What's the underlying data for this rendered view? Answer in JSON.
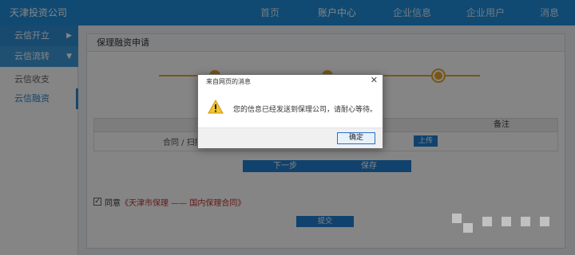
{
  "header": {
    "brand": "天津投资公司",
    "nav": [
      {
        "label": "首页"
      },
      {
        "label": "账户中心"
      },
      {
        "label": "企业信息"
      },
      {
        "label": "企业用户"
      },
      {
        "label": "消息"
      }
    ]
  },
  "sidebar": {
    "group1": "云信开立",
    "group2": "云信流转",
    "sub1": "云信收支",
    "sub2": "云信融资"
  },
  "main": {
    "panel_title": "保理融资申请",
    "table_head": {
      "col1": "",
      "col2": "",
      "col3": "备注"
    },
    "row": {
      "text": "合同 / 扫描",
      "upload": "上传"
    },
    "buttons": {
      "next": "下一步",
      "save": "保存"
    },
    "agree": {
      "label": "同意",
      "link": "《天津市保理 —— 国内保理合同》"
    },
    "submit": "提交"
  },
  "dialog": {
    "title": "来自网页的消息",
    "message": "您的信息已经发送到保理公司，请耐心等待。",
    "ok": "确定"
  }
}
